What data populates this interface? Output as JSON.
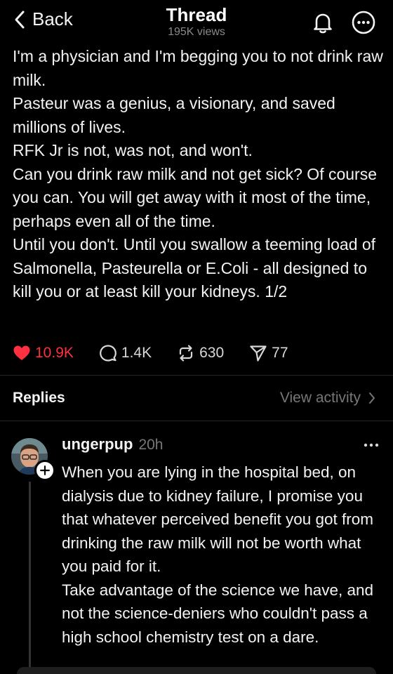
{
  "header": {
    "back_label": "Back",
    "title": "Thread",
    "views": "195K views"
  },
  "post": {
    "paragraphs": [
      "I'm a physician and I'm begging you to not drink raw milk.",
      "Pasteur was a genius, a visionary, and saved millions of lives.",
      "RFK Jr is not, was not, and won't.",
      "Can you drink raw milk and not get sick? Of course you can. You will get away with it most of the time, perhaps even all of the time.",
      "Until you don't. Until you swallow a teeming load of Salmonella, Pasteurella or E.Coli - all designed to kill you or at least kill your kidneys. 1/2"
    ],
    "likes": "10.9K",
    "replies_count": "1.4K",
    "reposts": "630",
    "shares": "77"
  },
  "replies_section": {
    "label": "Replies",
    "view_activity_label": "View activity"
  },
  "reply": {
    "username": "ungerpup",
    "time": "20h",
    "paragraphs": [
      "When you are lying in the hospital bed, on dialysis due to kidney failure, I promise you that whatever perceived benefit you got from drinking the raw milk will not be worth what you paid for it.",
      "Take advantage of the science we have, and not the science-deniers who couldn't pass a high school chemistry test on a dare."
    ]
  },
  "colors": {
    "background": "#000000",
    "text": "#f3f3f3",
    "muted": "#777777",
    "like_red": "#ff3040",
    "divider": "#262626"
  },
  "icons": [
    "chevron-left-icon",
    "bell-icon",
    "more-circle-icon",
    "heart-icon",
    "comment-icon",
    "repost-icon",
    "send-icon",
    "chevron-right-icon",
    "plus-icon",
    "more-dots-icon"
  ]
}
